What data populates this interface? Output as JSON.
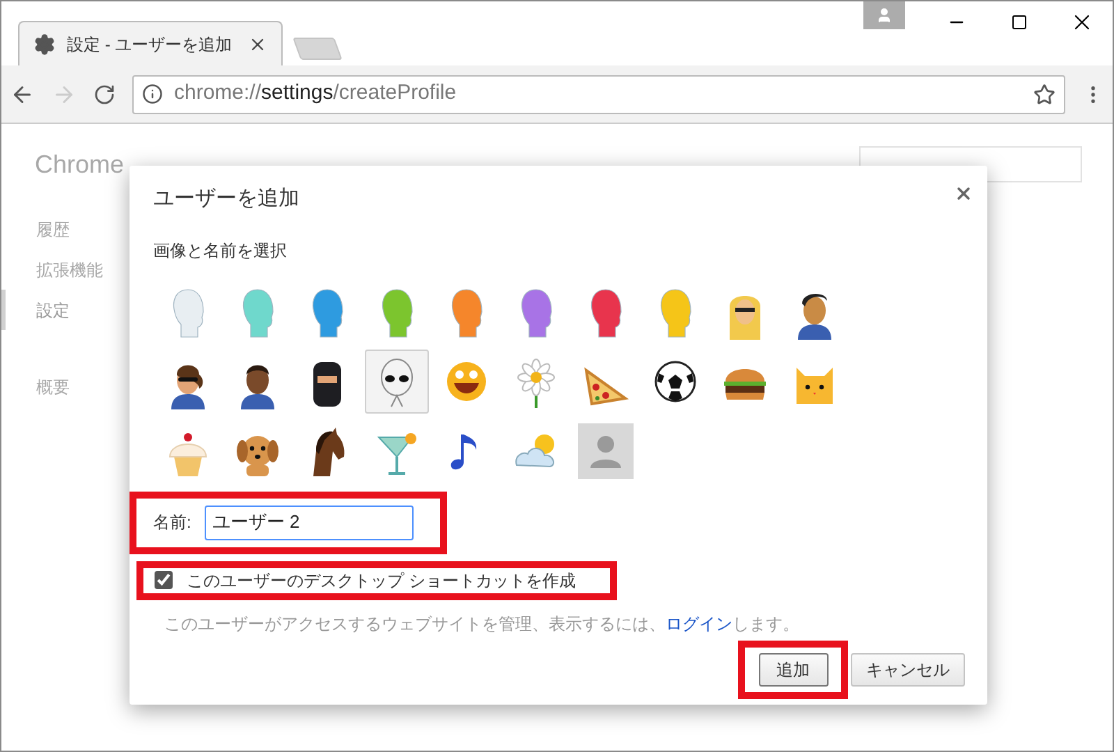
{
  "tab": {
    "title": "設定 - ユーザーを追加"
  },
  "address": {
    "scheme": "chrome://",
    "host": "settings",
    "path": "/createProfile"
  },
  "page": {
    "brand": "Chrome",
    "sidebar": [
      {
        "label": "履歴",
        "selected": false
      },
      {
        "label": "拡張機能",
        "selected": false
      },
      {
        "label": "設定",
        "selected": true
      },
      {
        "label": "概要",
        "selected": false
      }
    ]
  },
  "dialog": {
    "title": "ユーザーを追加",
    "subtitle": "画像と名前を選択",
    "avatars": [
      {
        "kind": "head",
        "color": "#e8eef2",
        "selected": false
      },
      {
        "kind": "head",
        "color": "#6fd8cc",
        "selected": false
      },
      {
        "kind": "head",
        "color": "#2e9be0",
        "selected": false
      },
      {
        "kind": "head",
        "color": "#7cc52e",
        "selected": false
      },
      {
        "kind": "head",
        "color": "#f5862b",
        "selected": false
      },
      {
        "kind": "head",
        "color": "#a873e6",
        "selected": false
      },
      {
        "kind": "head",
        "color": "#e8344d",
        "selected": false
      },
      {
        "kind": "head",
        "color": "#f5c518",
        "selected": false
      },
      {
        "kind": "blonde",
        "selected": false
      },
      {
        "kind": "hero",
        "selected": false
      },
      {
        "kind": "woman",
        "selected": false
      },
      {
        "kind": "man",
        "selected": false
      },
      {
        "kind": "ninja",
        "selected": false
      },
      {
        "kind": "alien",
        "selected": true
      },
      {
        "kind": "smiley",
        "selected": false
      },
      {
        "kind": "flower",
        "selected": false
      },
      {
        "kind": "pizza",
        "selected": false
      },
      {
        "kind": "ball",
        "selected": false
      },
      {
        "kind": "burger",
        "selected": false
      },
      {
        "kind": "cat",
        "selected": false
      },
      {
        "kind": "cupcake",
        "selected": false
      },
      {
        "kind": "dog",
        "selected": false
      },
      {
        "kind": "horse",
        "selected": false
      },
      {
        "kind": "cocktail",
        "selected": false
      },
      {
        "kind": "note",
        "selected": false
      },
      {
        "kind": "weather",
        "selected": false
      },
      {
        "kind": "placeholder",
        "selected": false
      }
    ],
    "name_label": "名前:",
    "name_value": "ユーザー 2",
    "name_highlighted": true,
    "shortcut": {
      "label": "このユーザーのデスクトップ ショートカットを作成",
      "checked": true,
      "highlighted": true
    },
    "info": {
      "before": "このユーザーがアクセスするウェブサイトを管理、表示するには、",
      "link": "ログイン",
      "after": "します。"
    },
    "buttons": [
      {
        "label": "追加",
        "kind": "primary",
        "highlighted": true
      },
      {
        "label": "キャンセル",
        "kind": "secondary",
        "highlighted": false
      }
    ]
  }
}
